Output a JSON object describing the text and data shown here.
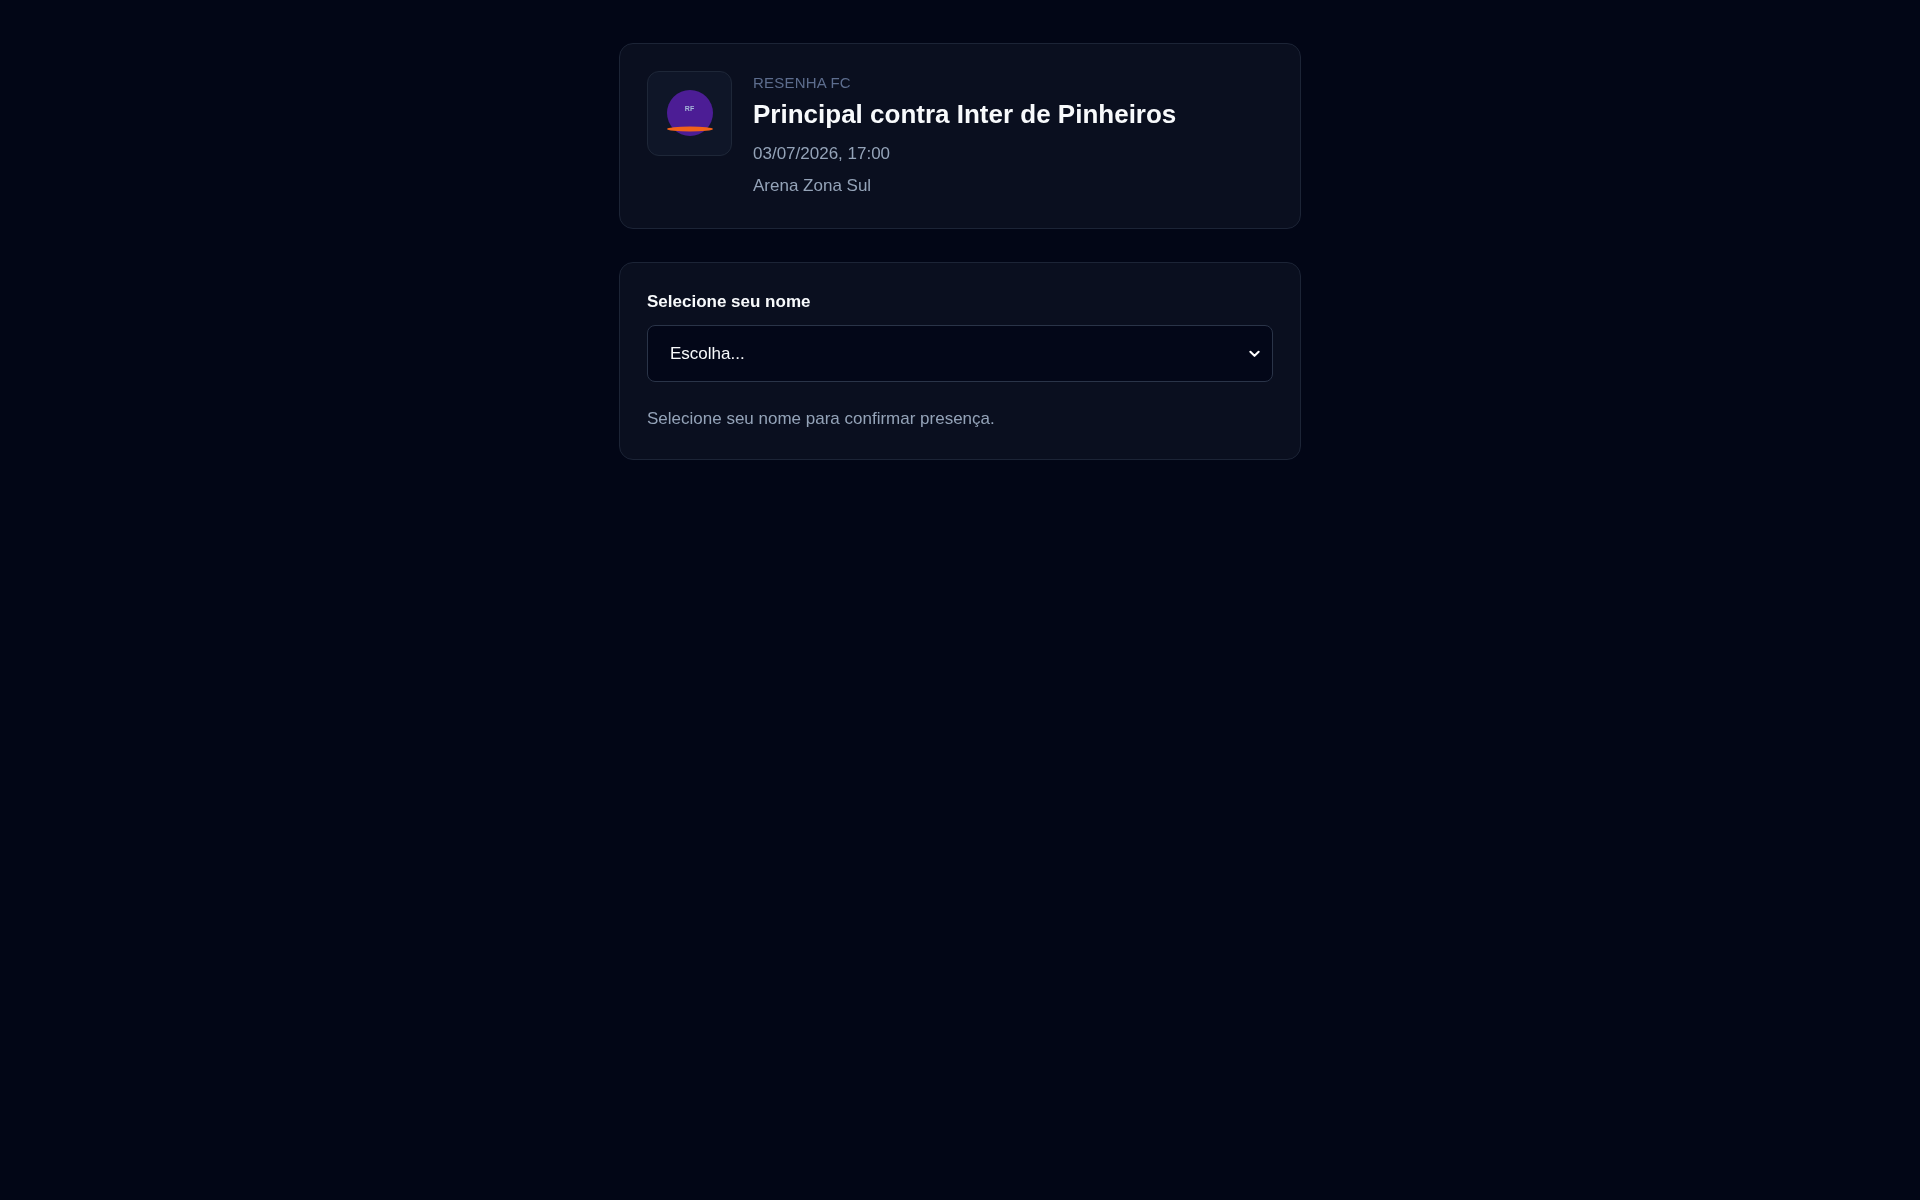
{
  "event_card": {
    "logo": {
      "initials": "RF"
    },
    "club": "RESENHA FC",
    "title": "Principal contra Inter de Pinheiros",
    "datetime": "03/07/2026, 17:00",
    "venue": "Arena Zona Sul"
  },
  "attendance_form": {
    "label": "Selecione seu nome",
    "name_select": {
      "value": "Escolha..."
    },
    "hint": "Selecione seu nome para confirmar presença."
  }
}
